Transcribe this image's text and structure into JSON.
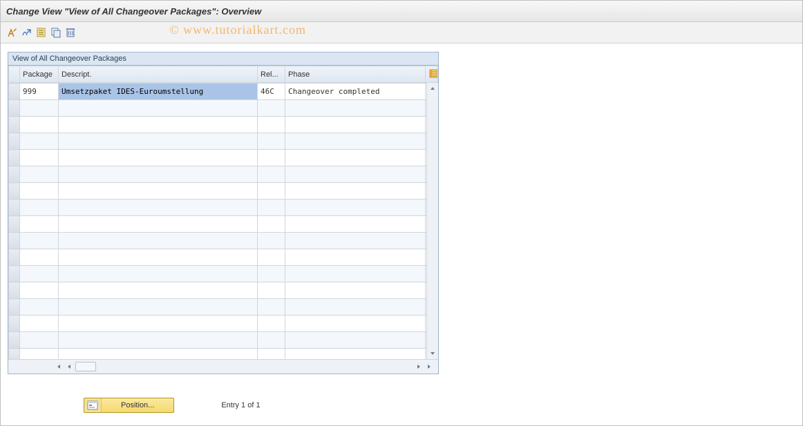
{
  "window": {
    "title": "Change View \"View of All Changeover Packages\": Overview"
  },
  "toolbar": {
    "items": [
      {
        "name": "toggle-display-change-icon"
      },
      {
        "name": "other-entry-icon"
      },
      {
        "name": "new-entries-icon"
      },
      {
        "name": "copy-as-icon"
      },
      {
        "name": "delete-icon"
      }
    ]
  },
  "watermark": "© www.tutorialkart.com",
  "panel": {
    "caption": "View of All Changeover Packages"
  },
  "grid": {
    "columns": [
      "Package",
      "Descript.",
      "Rel...",
      "Phase"
    ],
    "rows": [
      {
        "package": "999",
        "descript": "Umsetzpaket IDES-Euroumstellung",
        "rel": "46C",
        "phase": "Changeover completed"
      }
    ],
    "empty_row_count": 19
  },
  "footer": {
    "position_label": "Position...",
    "entry_status": "Entry 1 of 1"
  },
  "colors": {
    "header_bg": "#dbe6f2",
    "selected": "#a9c4e6",
    "accent_yellow": "#f5d96d"
  }
}
